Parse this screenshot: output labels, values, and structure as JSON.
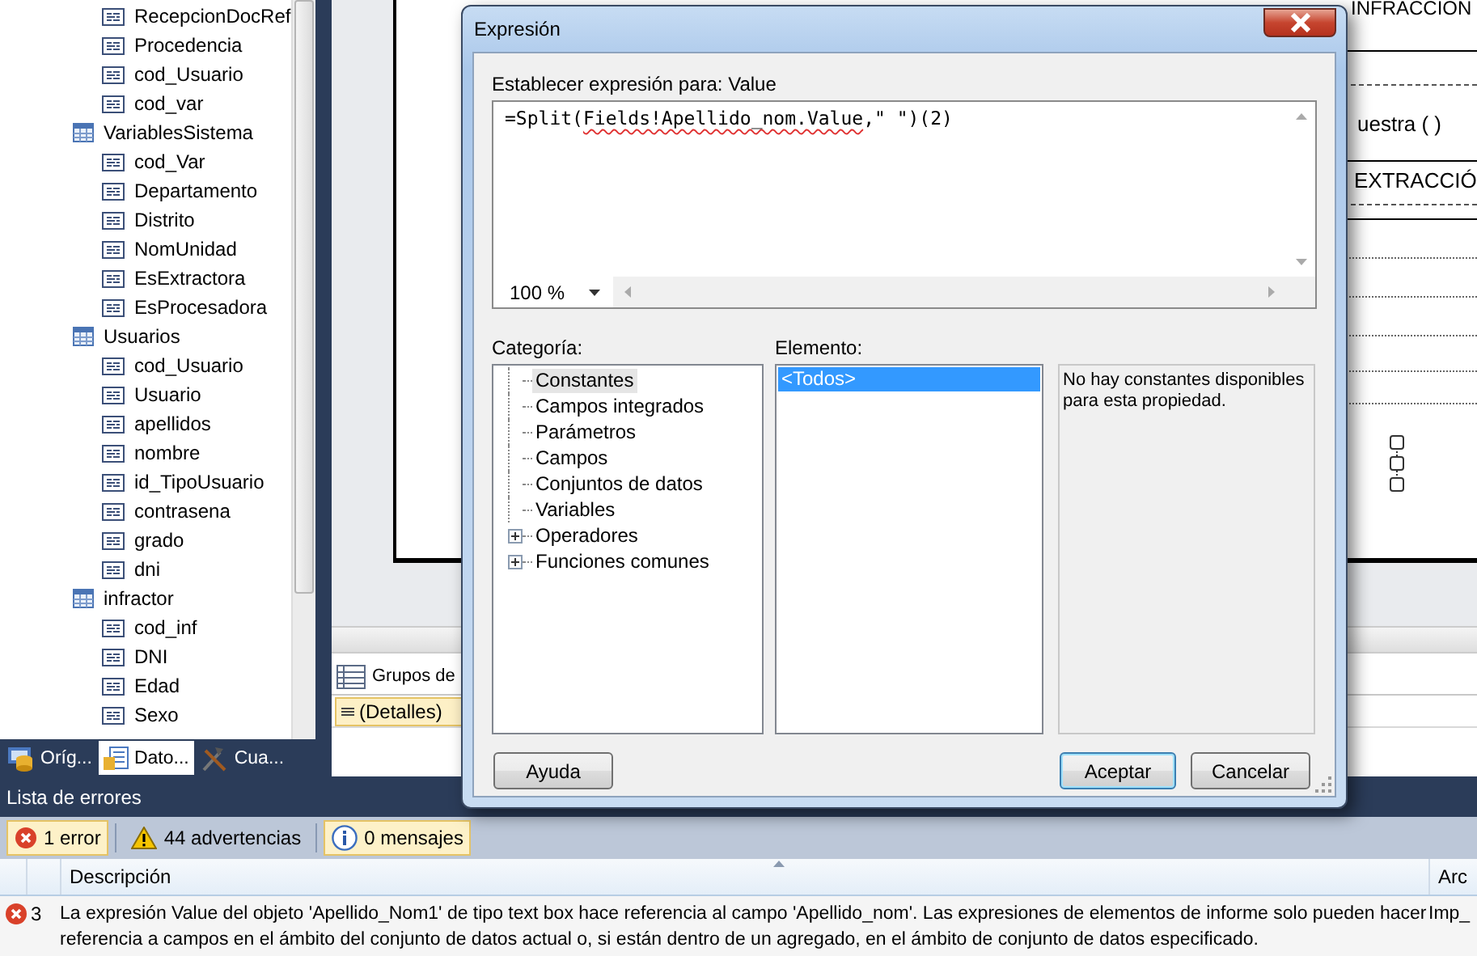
{
  "left_panel": {
    "tree": [
      {
        "children": [
          {
            "label": "RecepcionDocRef",
            "kind": "field"
          },
          {
            "label": "Procedencia",
            "kind": "field"
          },
          {
            "label": "cod_Usuario",
            "kind": "field"
          },
          {
            "label": "cod_var",
            "kind": "field"
          }
        ]
      },
      {
        "label": "VariablesSistema",
        "kind": "table",
        "children": [
          {
            "label": "cod_Var",
            "kind": "field"
          },
          {
            "label": "Departamento",
            "kind": "field"
          },
          {
            "label": "Distrito",
            "kind": "field"
          },
          {
            "label": "NomUnidad",
            "kind": "field"
          },
          {
            "label": "EsExtractora",
            "kind": "field"
          },
          {
            "label": "EsProcesadora",
            "kind": "field"
          }
        ]
      },
      {
        "label": "Usuarios",
        "kind": "table",
        "children": [
          {
            "label": "cod_Usuario",
            "kind": "field"
          },
          {
            "label": "Usuario",
            "kind": "field"
          },
          {
            "label": "apellidos",
            "kind": "field"
          },
          {
            "label": "nombre",
            "kind": "field"
          },
          {
            "label": "id_TipoUsuario",
            "kind": "field"
          },
          {
            "label": "contrasena",
            "kind": "field"
          },
          {
            "label": "grado",
            "kind": "field"
          },
          {
            "label": "dni",
            "kind": "field"
          }
        ]
      },
      {
        "label": "infractor",
        "kind": "table",
        "children": [
          {
            "label": "cod_inf",
            "kind": "field"
          },
          {
            "label": "DNI",
            "kind": "field"
          },
          {
            "label": "Edad",
            "kind": "field"
          },
          {
            "label": "Sexo",
            "kind": "field"
          }
        ]
      }
    ]
  },
  "panel_tabs": [
    {
      "label": "Oríg...",
      "kind": "sources",
      "selected": false
    },
    {
      "label": "Dato...",
      "kind": "data",
      "selected": true
    },
    {
      "label": "Cua...",
      "kind": "tools",
      "selected": false
    }
  ],
  "designer": {
    "report_texts": [
      "INFRACCION",
      "uestra ( )",
      "EXTRACCIÓ"
    ],
    "groups_label": "Grupos de",
    "group_item": "(Detalles)"
  },
  "dialog": {
    "title": "Expresión",
    "expression_label": "Establecer expresión para: Value",
    "expression": [
      {
        "text": "=Split(",
        "error": false
      },
      {
        "text": "Fields!Apellido_nom.Value",
        "error": true
      },
      {
        "text": ",\" \")(2)",
        "error": false
      }
    ],
    "zoom": "100 %",
    "category_label": "Categoría:",
    "categories": [
      {
        "label": "Constantes",
        "selected": true,
        "expandable": false
      },
      {
        "label": "Campos integrados",
        "selected": false,
        "expandable": false
      },
      {
        "label": "Parámetros",
        "selected": false,
        "expandable": false
      },
      {
        "label": "Campos",
        "selected": false,
        "expandable": false
      },
      {
        "label": "Conjuntos de datos",
        "selected": false,
        "expandable": false
      },
      {
        "label": "Variables",
        "selected": false,
        "expandable": false
      },
      {
        "label": "Operadores",
        "selected": false,
        "expandable": true
      },
      {
        "label": "Funciones comunes",
        "selected": false,
        "expandable": true
      }
    ],
    "element_label": "Elemento:",
    "elements": [
      {
        "label": "<Todos>",
        "selected": true
      }
    ],
    "description": "No hay constantes disponibles para esta propiedad.",
    "buttons": [
      {
        "label": "Ayuda",
        "kind": "help",
        "default": false
      },
      {
        "label": "Aceptar",
        "kind": "ok",
        "default": true
      },
      {
        "label": "Cancelar",
        "kind": "cancel",
        "default": false
      }
    ]
  },
  "error_list": {
    "title": "Lista de errores",
    "filters": [
      {
        "label": "1 error",
        "kind": "error",
        "selected": true
      },
      {
        "label": "44 advertencias",
        "kind": "warning",
        "selected": false
      },
      {
        "label": "0 mensajes",
        "kind": "info",
        "selected": true
      }
    ],
    "columns": [
      "Descripción",
      "Arc"
    ],
    "rows": [
      {
        "kind": "error",
        "number": "3",
        "description": "La expresión Value del objeto 'Apellido_Nom1' de tipo text box hace referencia al campo 'Apellido_nom'. Las expresiones de elementos de informe solo pueden hacer referencia a campos en el ámbito del conjunto de datos actual o, si están dentro de un agregado, en el ámbito de conjunto de datos especificado.",
        "file": "Imp_"
      }
    ]
  }
}
